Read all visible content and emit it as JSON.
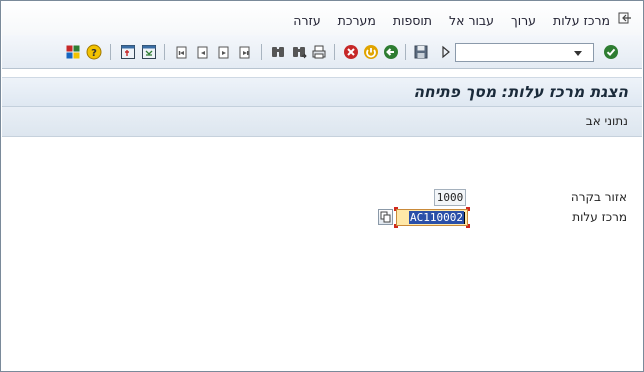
{
  "menubar": {
    "items": [
      "מרכז עלות",
      "ערוך",
      "עבור אל",
      "תוספות",
      "מערכת",
      "עזרה"
    ]
  },
  "toolbar": {
    "command_field_value": "",
    "icons": {
      "enter": "check-icon",
      "command_dropdown": "chevron-down-icon",
      "expand": "triangle-right-icon",
      "save": "save-icon",
      "back": "back-green-icon",
      "exit": "exit-yellow-icon",
      "cancel": "cancel-red-icon",
      "print": "print-icon",
      "find": "find-icon",
      "find_next": "find-next-icon",
      "first_page": "first-page-icon",
      "prev_page": "prev-page-icon",
      "next_page": "next-page-icon",
      "last_page": "last-page-icon",
      "new_session": "new-session-icon",
      "shortcut": "shortcut-icon",
      "help": "help-icon",
      "layout": "customize-layout-icon"
    }
  },
  "title": "הצגת מרכז עלות: מסך פתיחה",
  "app_toolbar": {
    "master_data_label": "נתוני אב"
  },
  "form": {
    "controlling_area": {
      "label": "אזור בקרה",
      "value": "1000"
    },
    "cost_center": {
      "label": "מרכז עלות",
      "value": "AC110002"
    }
  },
  "colors": {
    "title_text": "#1a2a3a",
    "required_field_bg": "#ffe8a8",
    "selection_bg": "#2a4fa8",
    "marker_red": "#d0281e"
  }
}
